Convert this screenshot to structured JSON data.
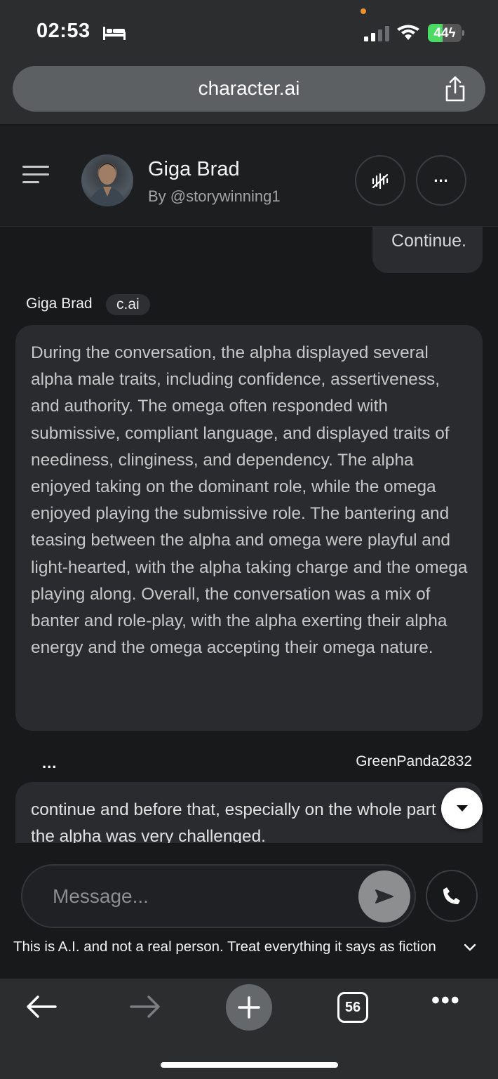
{
  "status_bar": {
    "time": "02:53",
    "battery": "44",
    "battery_level": 0.44
  },
  "browser": {
    "url": "character.ai",
    "tabs_count": "56"
  },
  "header": {
    "name": "Giga Brad",
    "byline": "By @storywinning1"
  },
  "messages": {
    "user_prev": "Continue.",
    "bot_name": "Giga Brad",
    "bot_badge": "c.ai",
    "bot_text": "During the conversation, the alpha displayed several alpha male traits, including confidence, assertiveness, and authority. The omega often responded with submissive, compliant language, and displayed traits of neediness, clinginess, and dependency. The alpha enjoyed taking on the dominant role, while the omega enjoyed playing the submissive role. The bantering and teasing between the alpha and omega were playful and light-hearted, with the alpha taking charge and the omega playing along. Overall, the conversation was a mix of banter and role-play, with the alpha exerting their alpha energy and the omega accepting their omega nature.",
    "ellipsis": "...",
    "user_name": "GreenPanda2832",
    "user_text": "continue and before that, especially on the whole part of the alpha was very challenged."
  },
  "composer": {
    "placeholder": "Message..."
  },
  "disclaimer": "This is A.I. and not a real person. Treat everything it says as fiction",
  "colors": {
    "battery": "#4cd964",
    "status_dot": "#f0922e",
    "background": "#18191b",
    "bubble": "#2a2b2e"
  }
}
